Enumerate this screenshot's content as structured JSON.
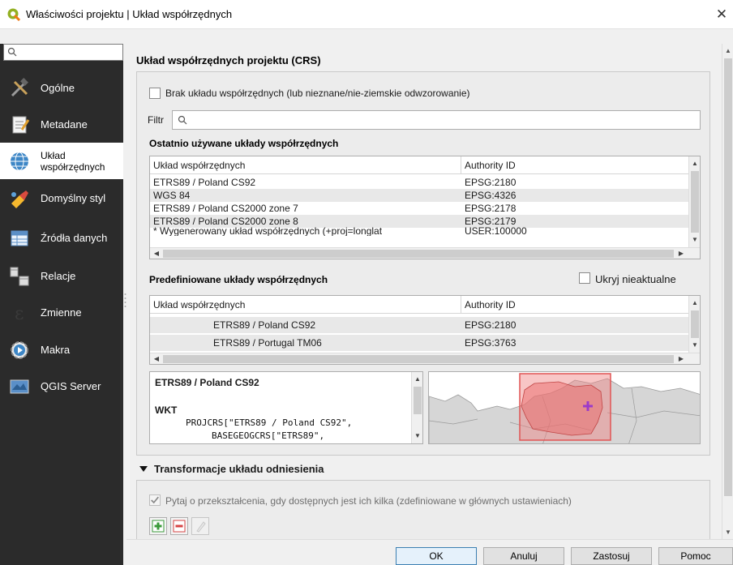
{
  "window": {
    "title": "Właściwości projektu | Układ współrzędnych",
    "close_glyph": "✕"
  },
  "sidebar": {
    "items": [
      {
        "label": "Ogólne",
        "icon": "wrench-hammer-icon"
      },
      {
        "label": "Metadane",
        "icon": "notepad-icon"
      },
      {
        "label": "Układ\nwspółrzędnych",
        "icon": "globe-icon",
        "active": true
      },
      {
        "label": "Domyślny styl",
        "icon": "paint-icon"
      },
      {
        "label": "Źródła danych",
        "icon": "table-icon"
      },
      {
        "label": "Relacje",
        "icon": "relations-icon"
      },
      {
        "label": "Zmienne",
        "icon": "epsilon-icon"
      },
      {
        "label": "Makra",
        "icon": "gear-play-icon"
      },
      {
        "label": "QGIS Server",
        "icon": "server-icon"
      }
    ]
  },
  "crs": {
    "section_title": "Układ współrzędnych projektu (CRS)",
    "no_crs_label": "Brak układu współrzędnych (lub nieznane/nie-ziemskie odwzorowanie)",
    "filter_label": "Filtr",
    "filter_value": "",
    "recent": {
      "title": "Ostatnio używane układy współrzędnych",
      "columns": [
        "Układ współrzędnych",
        "Authority ID"
      ],
      "rows": [
        {
          "name": "ETRS89 / Poland CS92",
          "id": "EPSG:2180"
        },
        {
          "name": "WGS 84",
          "id": "EPSG:4326"
        },
        {
          "name": "ETRS89 / Poland CS2000 zone 7",
          "id": "EPSG:2178"
        },
        {
          "name": "ETRS89 / Poland CS2000 zone 8",
          "id": "EPSG:2179"
        },
        {
          "name": "* Wygenerowany układ współrzędnych (+proj=longlat",
          "id": "USER:100000"
        }
      ]
    },
    "predefined": {
      "title": "Predefiniowane układy współrzędnych",
      "hide_deprecated_label": "Ukryj nieaktualne",
      "columns": [
        "Układ współrzędnych",
        "Authority ID"
      ],
      "rows": [
        {
          "name": "ETRS89 / Poland CS92",
          "id": "EPSG:2180"
        },
        {
          "name": "ETRS89 / Portugal TM06",
          "id": "EPSG:3763"
        }
      ]
    },
    "details": {
      "title": "ETRS89 / Poland CS92",
      "wkt_label": "WKT",
      "wkt_line1": "PROJCRS[\"ETRS89 / Poland CS92\",",
      "wkt_line2": "BASEGEOGCRS[\"ETRS89\","
    }
  },
  "transform": {
    "title": "Transformacje układu odniesienia",
    "ask_label": "Pytaj o przekształcenia, gdy dostępnych jest ich kilka (zdefiniowane w głównych ustawieniach)"
  },
  "footer": {
    "ok": "OK",
    "cancel": "Anuluj",
    "apply": "Zastosuj",
    "help": "Pomoc"
  },
  "colors": {
    "sidebar_bg": "#2b2b2b",
    "map_extent": "#f08080",
    "accent": "#3c7fb1"
  }
}
